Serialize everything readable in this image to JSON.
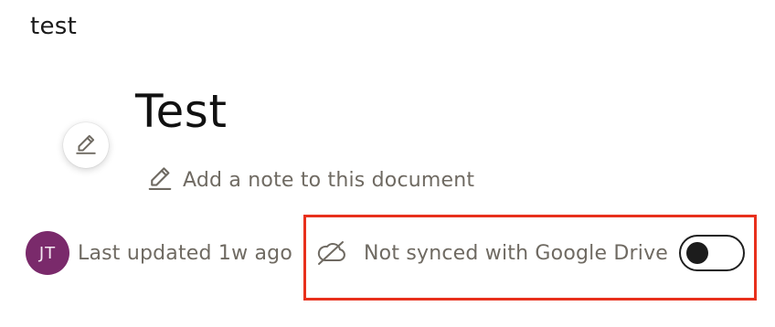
{
  "header": {
    "breadcrumb": "test"
  },
  "document": {
    "title": "Test",
    "add_note_label": "Add a note to this document"
  },
  "meta": {
    "avatar_initials": "JT",
    "avatar_color": "#7a2a6b",
    "last_updated": "Last updated 1w ago"
  },
  "sync": {
    "label": "Not synced with Google Drive",
    "icon": "cloud-off-icon",
    "enabled": false,
    "highlight_color": "#e8301c"
  },
  "icons": {
    "edit_fab": "pencil-icon",
    "add_note": "pencil-icon"
  }
}
